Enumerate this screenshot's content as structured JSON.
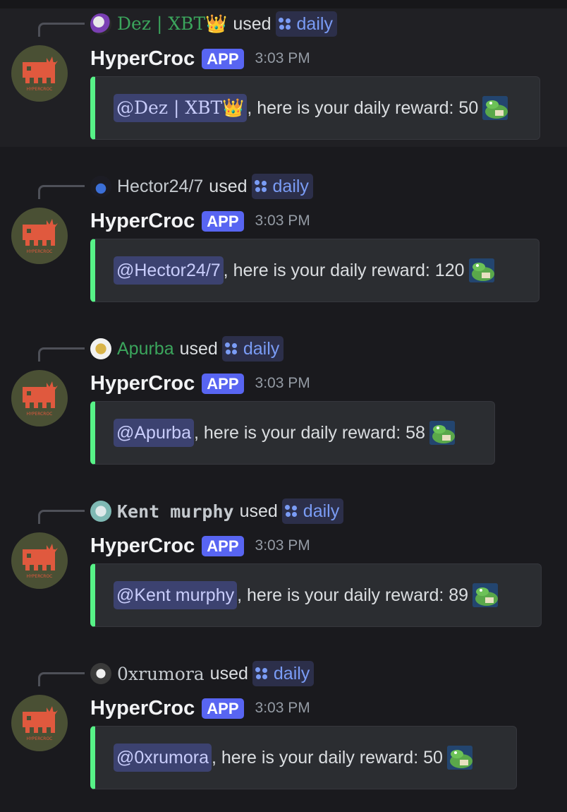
{
  "bot": {
    "name": "HyperCroc",
    "badge": "APP",
    "avatar_icon": "hypercroc-logo-icon",
    "avatar_caption": "HYPERCROC",
    "avatar_bg": "#4a5034",
    "logo_color": "#e0593e"
  },
  "used_label": "used",
  "command_label": "daily",
  "messages": [
    {
      "user": "Dez | XBT👑",
      "user_color": "#3ba55c",
      "avatar_icon": "user-avatar-icon",
      "time": "3:03 PM",
      "mention": "@Dez | XBT👑",
      "text": ", here is your daily reward: 50",
      "highlighted": true
    },
    {
      "user": "Hector24/7",
      "user_color": "#c4c9ce",
      "avatar_icon": "user-avatar-icon",
      "time": "3:03 PM",
      "mention": "@Hector24/7",
      "text": ", here is your daily reward: 120",
      "highlighted": false
    },
    {
      "user": "Apurba",
      "user_color": "#3ba55c",
      "avatar_icon": "user-avatar-icon",
      "time": "3:03 PM",
      "mention": "@Apurba",
      "text": ", here is your daily reward: 58",
      "highlighted": false
    },
    {
      "user": "Kent murphy",
      "user_color": "#c4c9ce",
      "avatar_icon": "user-avatar-icon",
      "time": "3:03 PM",
      "mention": "@Kent murphy",
      "text": ", here is your daily reward: 89",
      "highlighted": false
    },
    {
      "user": "0xrumora",
      "user_color": "#c4c9ce",
      "avatar_icon": "user-avatar-icon",
      "time": "3:03 PM",
      "mention": "@0xrumora",
      "text": ", here is your daily reward: 50",
      "highlighted": false
    }
  ]
}
